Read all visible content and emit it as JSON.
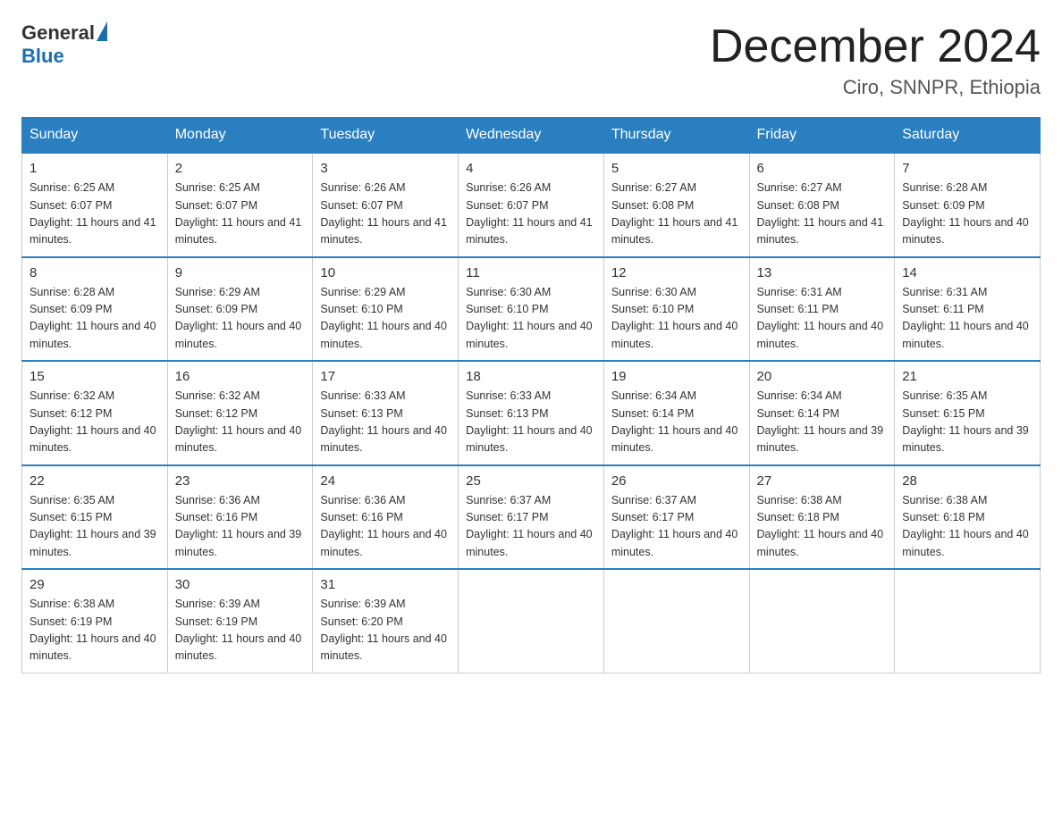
{
  "logo": {
    "general": "General",
    "blue": "Blue"
  },
  "title": "December 2024",
  "location": "Ciro, SNNPR, Ethiopia",
  "days_of_week": [
    "Sunday",
    "Monday",
    "Tuesday",
    "Wednesday",
    "Thursday",
    "Friday",
    "Saturday"
  ],
  "weeks": [
    [
      {
        "day": "1",
        "sunrise": "6:25 AM",
        "sunset": "6:07 PM",
        "daylight": "11 hours and 41 minutes."
      },
      {
        "day": "2",
        "sunrise": "6:25 AM",
        "sunset": "6:07 PM",
        "daylight": "11 hours and 41 minutes."
      },
      {
        "day": "3",
        "sunrise": "6:26 AM",
        "sunset": "6:07 PM",
        "daylight": "11 hours and 41 minutes."
      },
      {
        "day": "4",
        "sunrise": "6:26 AM",
        "sunset": "6:07 PM",
        "daylight": "11 hours and 41 minutes."
      },
      {
        "day": "5",
        "sunrise": "6:27 AM",
        "sunset": "6:08 PM",
        "daylight": "11 hours and 41 minutes."
      },
      {
        "day": "6",
        "sunrise": "6:27 AM",
        "sunset": "6:08 PM",
        "daylight": "11 hours and 41 minutes."
      },
      {
        "day": "7",
        "sunrise": "6:28 AM",
        "sunset": "6:09 PM",
        "daylight": "11 hours and 40 minutes."
      }
    ],
    [
      {
        "day": "8",
        "sunrise": "6:28 AM",
        "sunset": "6:09 PM",
        "daylight": "11 hours and 40 minutes."
      },
      {
        "day": "9",
        "sunrise": "6:29 AM",
        "sunset": "6:09 PM",
        "daylight": "11 hours and 40 minutes."
      },
      {
        "day": "10",
        "sunrise": "6:29 AM",
        "sunset": "6:10 PM",
        "daylight": "11 hours and 40 minutes."
      },
      {
        "day": "11",
        "sunrise": "6:30 AM",
        "sunset": "6:10 PM",
        "daylight": "11 hours and 40 minutes."
      },
      {
        "day": "12",
        "sunrise": "6:30 AM",
        "sunset": "6:10 PM",
        "daylight": "11 hours and 40 minutes."
      },
      {
        "day": "13",
        "sunrise": "6:31 AM",
        "sunset": "6:11 PM",
        "daylight": "11 hours and 40 minutes."
      },
      {
        "day": "14",
        "sunrise": "6:31 AM",
        "sunset": "6:11 PM",
        "daylight": "11 hours and 40 minutes."
      }
    ],
    [
      {
        "day": "15",
        "sunrise": "6:32 AM",
        "sunset": "6:12 PM",
        "daylight": "11 hours and 40 minutes."
      },
      {
        "day": "16",
        "sunrise": "6:32 AM",
        "sunset": "6:12 PM",
        "daylight": "11 hours and 40 minutes."
      },
      {
        "day": "17",
        "sunrise": "6:33 AM",
        "sunset": "6:13 PM",
        "daylight": "11 hours and 40 minutes."
      },
      {
        "day": "18",
        "sunrise": "6:33 AM",
        "sunset": "6:13 PM",
        "daylight": "11 hours and 40 minutes."
      },
      {
        "day": "19",
        "sunrise": "6:34 AM",
        "sunset": "6:14 PM",
        "daylight": "11 hours and 40 minutes."
      },
      {
        "day": "20",
        "sunrise": "6:34 AM",
        "sunset": "6:14 PM",
        "daylight": "11 hours and 39 minutes."
      },
      {
        "day": "21",
        "sunrise": "6:35 AM",
        "sunset": "6:15 PM",
        "daylight": "11 hours and 39 minutes."
      }
    ],
    [
      {
        "day": "22",
        "sunrise": "6:35 AM",
        "sunset": "6:15 PM",
        "daylight": "11 hours and 39 minutes."
      },
      {
        "day": "23",
        "sunrise": "6:36 AM",
        "sunset": "6:16 PM",
        "daylight": "11 hours and 39 minutes."
      },
      {
        "day": "24",
        "sunrise": "6:36 AM",
        "sunset": "6:16 PM",
        "daylight": "11 hours and 40 minutes."
      },
      {
        "day": "25",
        "sunrise": "6:37 AM",
        "sunset": "6:17 PM",
        "daylight": "11 hours and 40 minutes."
      },
      {
        "day": "26",
        "sunrise": "6:37 AM",
        "sunset": "6:17 PM",
        "daylight": "11 hours and 40 minutes."
      },
      {
        "day": "27",
        "sunrise": "6:38 AM",
        "sunset": "6:18 PM",
        "daylight": "11 hours and 40 minutes."
      },
      {
        "day": "28",
        "sunrise": "6:38 AM",
        "sunset": "6:18 PM",
        "daylight": "11 hours and 40 minutes."
      }
    ],
    [
      {
        "day": "29",
        "sunrise": "6:38 AM",
        "sunset": "6:19 PM",
        "daylight": "11 hours and 40 minutes."
      },
      {
        "day": "30",
        "sunrise": "6:39 AM",
        "sunset": "6:19 PM",
        "daylight": "11 hours and 40 minutes."
      },
      {
        "day": "31",
        "sunrise": "6:39 AM",
        "sunset": "6:20 PM",
        "daylight": "11 hours and 40 minutes."
      },
      null,
      null,
      null,
      null
    ]
  ]
}
